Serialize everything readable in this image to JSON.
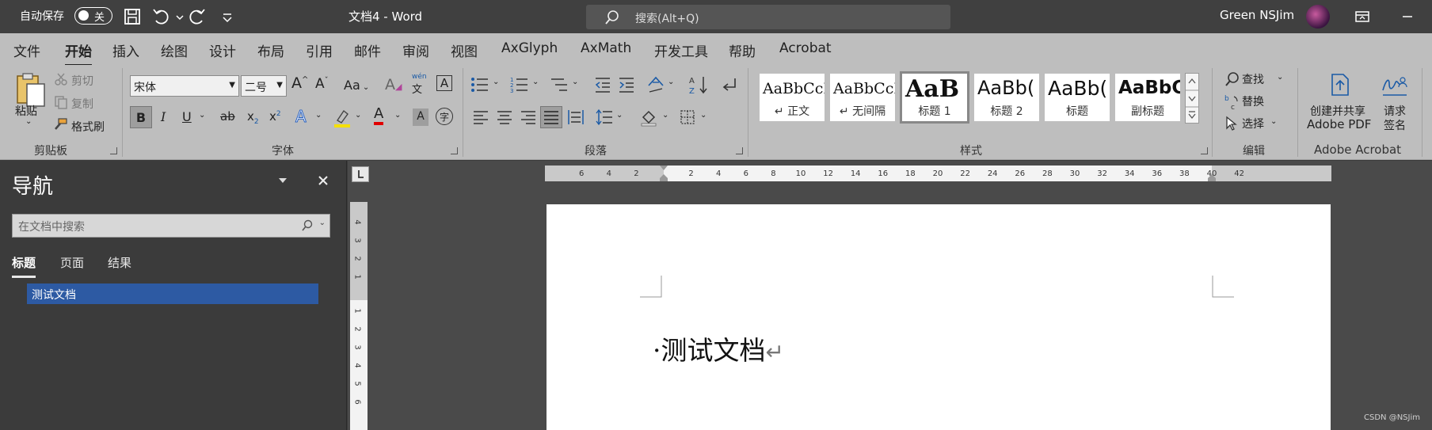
{
  "titlebar": {
    "autosave_label": "自动保存",
    "autosave_state": "关",
    "title": "文档4  -  Word",
    "search_placeholder": "搜索(Alt+Q)",
    "user_name": "Green NSJim"
  },
  "menu_tabs": [
    "文件",
    "开始",
    "插入",
    "绘图",
    "设计",
    "布局",
    "引用",
    "邮件",
    "审阅",
    "视图",
    "AxGlyph",
    "AxMath",
    "开发工具",
    "帮助",
    "Acrobat"
  ],
  "ribbon": {
    "clipboard": {
      "paste": "粘贴",
      "cut": "剪切",
      "copy": "复制",
      "format_painter": "格式刷",
      "group_label": "剪贴板"
    },
    "font": {
      "font_name": "宋体",
      "font_size": "二号",
      "group_label": "字体",
      "change_case": "Aa",
      "phonetic_top": "wén",
      "phonetic_bottom": "文",
      "border_char": "A",
      "bold": "B",
      "italic": "I",
      "underline": "U",
      "strike": "ab",
      "sub": "x",
      "sup": "x",
      "text_effect": "A",
      "font_color": "A",
      "shading": "A",
      "enclose": "字",
      "grow": "A",
      "shrink": "A",
      "highlight_color": "#f5e000",
      "font_color_hex": "#e00000"
    },
    "paragraph": {
      "group_label": "段落"
    },
    "styles": {
      "group_label": "样式",
      "items": [
        {
          "sample": "AaBbCcI",
          "name": "↵ 正文"
        },
        {
          "sample": "AaBbCcI",
          "name": "↵ 无间隔"
        },
        {
          "sample": "AaB",
          "name": "标题 1"
        },
        {
          "sample": "AaBb(",
          "name": "标题 2"
        },
        {
          "sample": "AaBb(",
          "name": "标题"
        },
        {
          "sample": "AaBbC",
          "name": "副标题"
        }
      ]
    },
    "editing": {
      "find": "查找",
      "replace": "替换",
      "select": "选择",
      "group_label": "编辑"
    },
    "acrobat": {
      "create_line1": "创建并共享",
      "create_line2": "Adobe PDF",
      "request_line1": "请求",
      "request_line2": "签名",
      "group_label": "Adobe Acrobat"
    }
  },
  "nav": {
    "title": "导航",
    "search_placeholder": "在文档中搜索",
    "tabs": [
      "标题",
      "页面",
      "结果"
    ],
    "heading_item": "测试文档"
  },
  "ruler": {
    "h_ticks": [
      "6",
      "4",
      "2",
      "2",
      "4",
      "6",
      "8",
      "10",
      "12",
      "14",
      "16",
      "18",
      "20",
      "22",
      "24",
      "26",
      "28",
      "30",
      "32",
      "34",
      "36",
      "38",
      "40",
      "42"
    ],
    "v_ticks": [
      "4",
      "3",
      "2",
      "1",
      "1",
      "2",
      "3",
      "4",
      "5",
      "6"
    ]
  },
  "document": {
    "text": "测试文档",
    "bullet": "·",
    "para_mark": "↵"
  },
  "watermark": "CSDN @NSJim"
}
